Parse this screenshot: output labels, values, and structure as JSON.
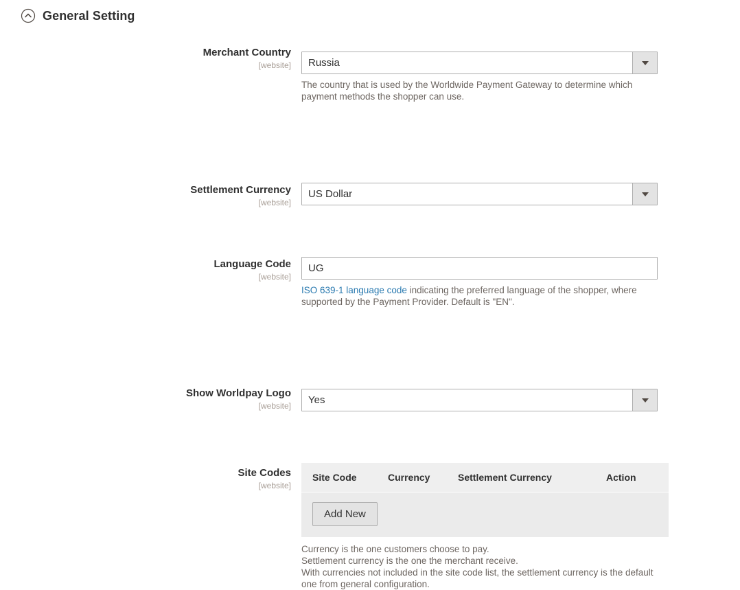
{
  "section": {
    "title": "General Setting",
    "collapse_icon": "chevron-up-circle-icon"
  },
  "fields": {
    "merchant_country": {
      "label": "Merchant Country",
      "scope": "[website]",
      "value": "Russia",
      "control": "select",
      "note": "The country that is used by the Worldwide Payment Gateway to determine which payment methods the shopper can use."
    },
    "settlement_currency": {
      "label": "Settlement Currency",
      "scope": "[website]",
      "value": "US Dollar",
      "control": "select"
    },
    "language_code": {
      "label": "Language Code",
      "scope": "[website]",
      "value": "UG",
      "control": "text",
      "note_link": "ISO 639-1 language code",
      "note_rest": " indicating the preferred language of the shopper, where supported by the Payment Provider. Default is \"EN\"."
    },
    "show_worldpay_logo": {
      "label": "Show Worldpay Logo",
      "scope": "[website]",
      "value": "Yes",
      "control": "select"
    },
    "site_codes": {
      "label": "Site Codes",
      "scope": "[website]",
      "columns": [
        "Site Code",
        "Currency",
        "Settlement Currency",
        "Action"
      ],
      "rows": [],
      "add_button": "Add New",
      "note_line1": "Currency is the one customers choose to pay.",
      "note_line2": "Settlement currency is the one the merchant receive.",
      "note_line3": "With currencies not included in the site code list, the settlement currency is the default one from general configuration."
    }
  },
  "colors": {
    "page_bg": "#ffffff",
    "text": "#303030",
    "scope_text": "#a79d95",
    "note_text": "#6d6661",
    "link": "#2a7ab0",
    "input_border": "#adadad",
    "button_bg": "#e3e3e3",
    "table_header_bg": "#efefef",
    "table_body_bg": "#ebebeb"
  }
}
